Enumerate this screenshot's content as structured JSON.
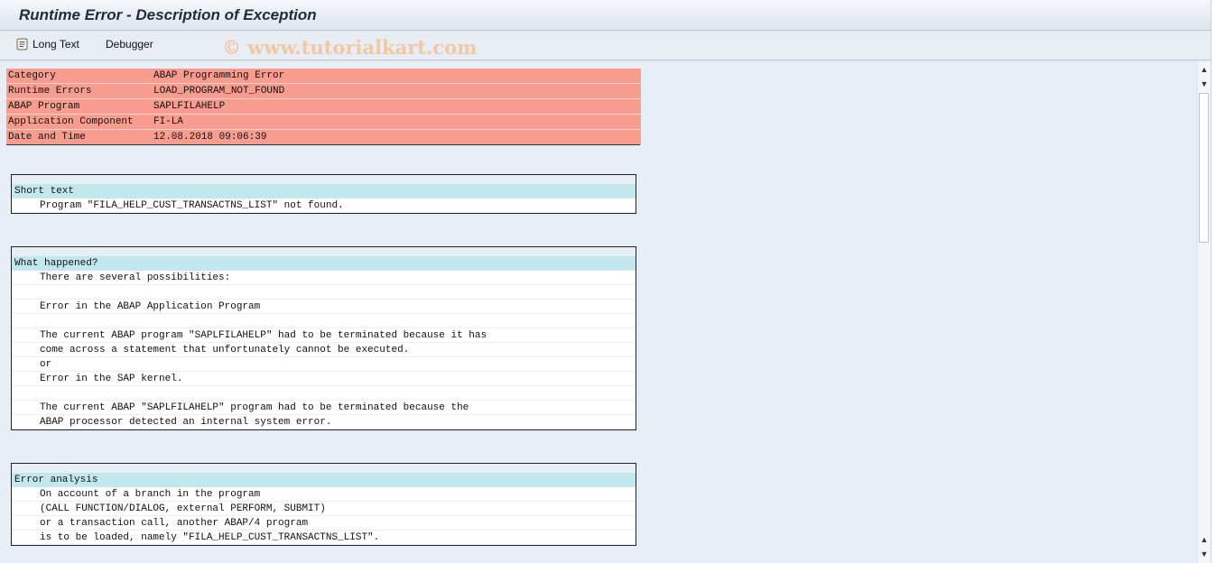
{
  "window": {
    "title": "Runtime Error - Description of Exception"
  },
  "toolbar": {
    "long_text_label": "Long Text",
    "debugger_label": "Debugger",
    "watermark": "© www.tutorialkart.com"
  },
  "header_info": [
    {
      "key": "Category",
      "value": "ABAP Programming Error"
    },
    {
      "key": "Runtime Errors",
      "value": "LOAD_PROGRAM_NOT_FOUND"
    },
    {
      "key": "ABAP Program",
      "value": "SAPLFILAHELP"
    },
    {
      "key": "Application Component",
      "value": "FI-LA"
    },
    {
      "key": "Date and Time",
      "value": "12.08.2018 09:06:39"
    }
  ],
  "sections": {
    "short_text": {
      "heading": "Short text",
      "lines": [
        "Program \"FILA_HELP_CUST_TRANSACTNS_LIST\" not found."
      ]
    },
    "what_happened": {
      "heading": "What happened?",
      "lines": [
        "There are several possibilities:",
        "",
        "Error in the ABAP Application Program",
        "",
        "The current ABAP program \"SAPLFILAHELP\" had to be terminated because it has",
        "come across a statement that unfortunately cannot be executed.",
        "or",
        "Error in the SAP kernel.",
        "",
        "The current ABAP \"SAPLFILAHELP\" program had to be terminated because the",
        "ABAP processor detected an internal system error."
      ]
    },
    "error_analysis": {
      "heading": "Error analysis",
      "lines": [
        "On account of a branch in the program",
        "(CALL FUNCTION/DIALOG, external PERFORM, SUBMIT)",
        "or a transaction call, another ABAP/4 program",
        "is to be loaded, namely \"FILA_HELP_CUST_TRANSACTNS_LIST\"."
      ]
    }
  }
}
